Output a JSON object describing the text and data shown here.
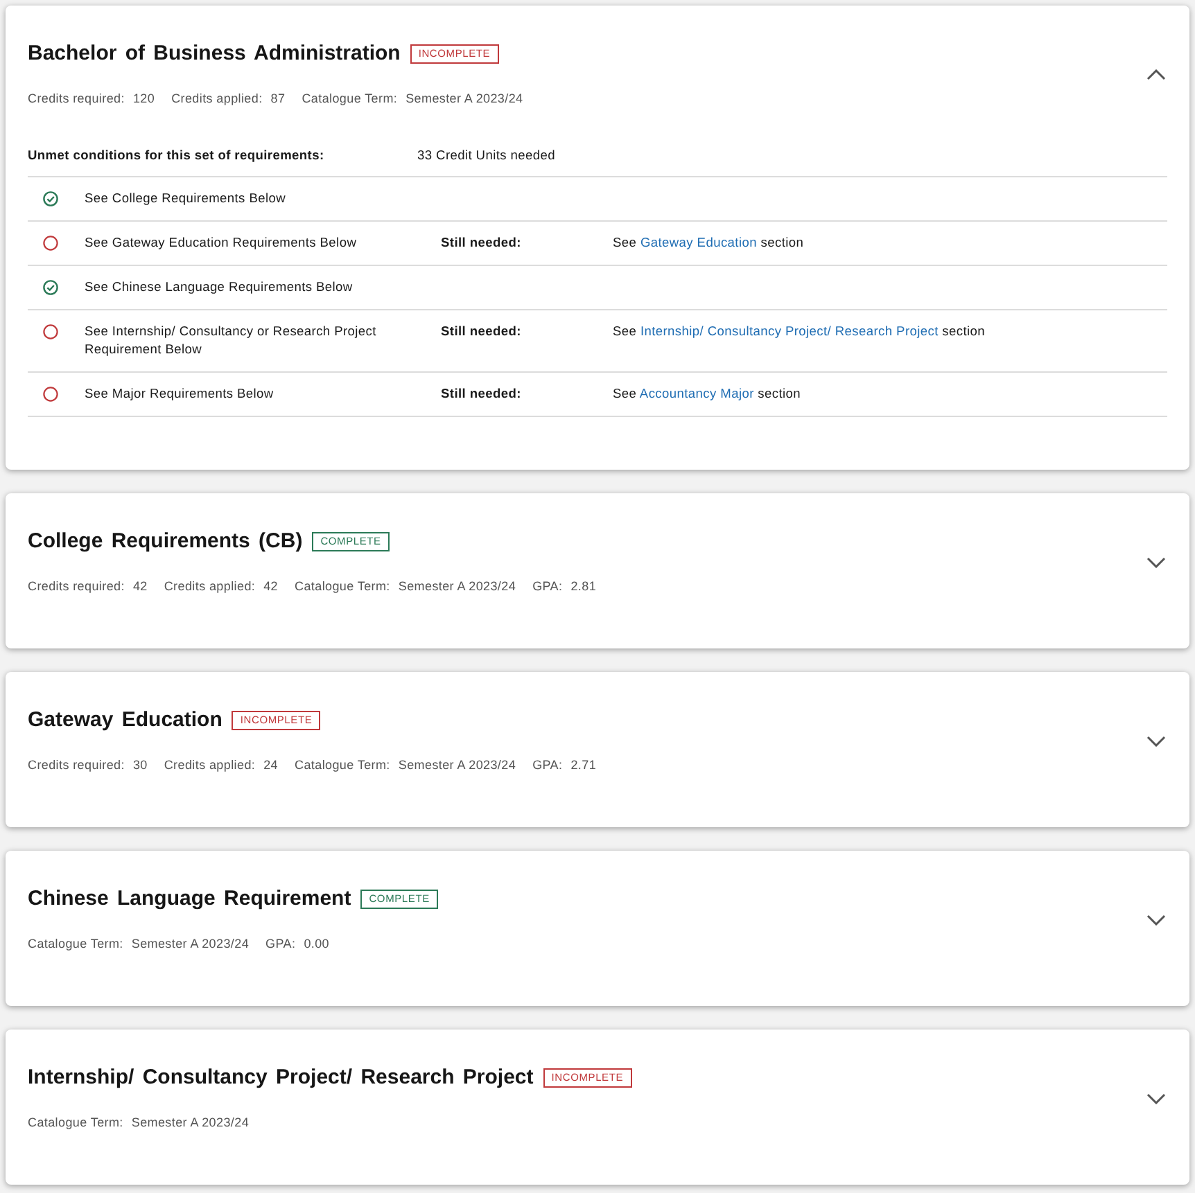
{
  "sections": [
    {
      "title": "Bachelor of Business Administration",
      "status": {
        "label": "INCOMPLETE",
        "kind": "incomplete"
      },
      "expanded": true,
      "meta": [
        {
          "label": "Credits required:",
          "value": "120"
        },
        {
          "label": "Credits applied:",
          "value": "87"
        },
        {
          "label": "Catalogue Term:",
          "value": "Semester A 2023/24"
        }
      ],
      "unmet": {
        "label": "Unmet conditions for this set of requirements:",
        "summary": "33 Credit Units needed",
        "rows": [
          {
            "met": true,
            "requirement": "See College Requirements Below"
          },
          {
            "met": false,
            "requirement": "See Gateway Education Requirements Below",
            "still_label": "Still needed:",
            "detail": {
              "prefix": "See",
              "link": "Gateway Education",
              "suffix": "section"
            }
          },
          {
            "met": true,
            "requirement": "See Chinese Language Requirements Below"
          },
          {
            "met": false,
            "requirement": "See Internship/ Consultancy or Research Project Requirement Below",
            "still_label": "Still needed:",
            "detail": {
              "prefix": "See",
              "link": "Internship/ Consultancy Project/ Research Project",
              "suffix": "section"
            }
          },
          {
            "met": false,
            "requirement": "See Major Requirements Below",
            "still_label": "Still needed:",
            "detail": {
              "prefix": "See",
              "link": "Accountancy Major",
              "suffix": "section"
            }
          }
        ]
      }
    },
    {
      "title": "College Requirements (CB)",
      "status": {
        "label": "COMPLETE",
        "kind": "complete"
      },
      "expanded": false,
      "meta": [
        {
          "label": "Credits required:",
          "value": "42"
        },
        {
          "label": "Credits applied:",
          "value": "42"
        },
        {
          "label": "Catalogue Term:",
          "value": "Semester A 2023/24"
        },
        {
          "label": "GPA:",
          "value": "2.81"
        }
      ]
    },
    {
      "title": "Gateway Education",
      "status": {
        "label": "INCOMPLETE",
        "kind": "incomplete"
      },
      "expanded": false,
      "meta": [
        {
          "label": "Credits required:",
          "value": "30"
        },
        {
          "label": "Credits applied:",
          "value": "24"
        },
        {
          "label": "Catalogue Term:",
          "value": "Semester A 2023/24"
        },
        {
          "label": "GPA:",
          "value": "2.71"
        }
      ]
    },
    {
      "title": "Chinese Language Requirement",
      "status": {
        "label": "COMPLETE",
        "kind": "complete"
      },
      "expanded": false,
      "meta": [
        {
          "label": "Catalogue Term:",
          "value": "Semester A 2023/24"
        },
        {
          "label": "GPA:",
          "value": "0.00"
        }
      ]
    },
    {
      "title": "Internship/ Consultancy Project/ Research Project",
      "status": {
        "label": "INCOMPLETE",
        "kind": "incomplete"
      },
      "expanded": false,
      "meta": [
        {
          "label": "Catalogue Term:",
          "value": "Semester A 2023/24"
        }
      ]
    }
  ]
}
